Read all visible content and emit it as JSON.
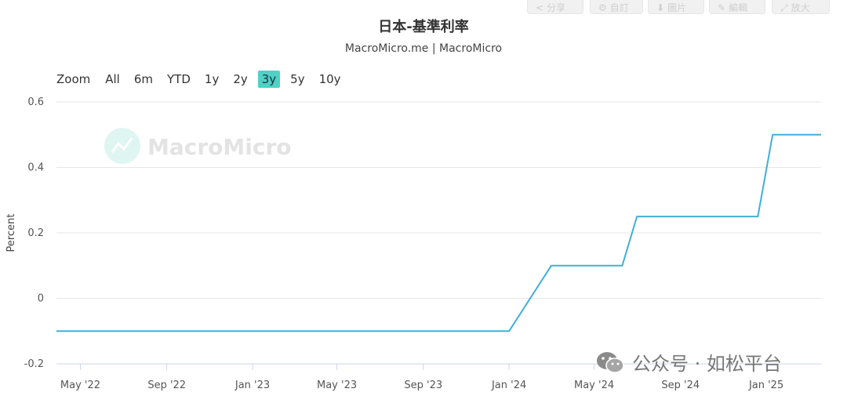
{
  "header": {
    "title": "日本-基準利率",
    "subtitle": "MacroMicro.me | MacroMicro"
  },
  "toolbar": {
    "buttons": [
      {
        "icon": "share-icon",
        "label": "分享"
      },
      {
        "icon": "gear-icon",
        "label": "自訂"
      },
      {
        "icon": "download-icon",
        "label": "圖片"
      },
      {
        "icon": "pencil-icon",
        "label": "編輯"
      },
      {
        "icon": "expand-icon",
        "label": "放大"
      }
    ]
  },
  "range_selector": {
    "zoom_label": "Zoom",
    "options": [
      "All",
      "6m",
      "YTD",
      "1y",
      "2y",
      "3y",
      "5y",
      "10y"
    ],
    "selected": "3y"
  },
  "watermark": {
    "text": "MacroMicro"
  },
  "wechat_badge": {
    "text": "公众号 · 如松平台"
  },
  "colors": {
    "line": "#41afd6",
    "accent": "#4fd1c5",
    "grid": "#e6e6e6"
  },
  "chart_data": {
    "type": "line",
    "title": "日本-基準利率",
    "subtitle": "MacroMicro.me | MacroMicro",
    "ylabel": "Percent",
    "xlabel": "",
    "ylim": [
      -0.2,
      0.6
    ],
    "yticks": [
      -0.2,
      0,
      0.2,
      0.4,
      0.6
    ],
    "ytick_labels": [
      "-0.2",
      "0",
      "0.2",
      "0.4",
      "0.6"
    ],
    "xlim": [
      "2022-03-28",
      "2025-03-20"
    ],
    "xticks": [
      "2022-05-01",
      "2022-09-01",
      "2023-01-01",
      "2023-05-01",
      "2023-09-01",
      "2024-01-01",
      "2024-05-01",
      "2024-09-01",
      "2025-01-01"
    ],
    "xtick_labels": [
      "May '22",
      "Sep '22",
      "Jan '23",
      "May '23",
      "Sep '23",
      "Jan '24",
      "May '24",
      "Sep '24",
      "Jan '25"
    ],
    "grid": true,
    "legend": "none",
    "series": [
      {
        "x": [
          "2022-03-28",
          "2024-01-01",
          "2024-03-01",
          "2024-06-10",
          "2024-07-01",
          "2024-12-20",
          "2025-01-10",
          "2025-03-20"
        ],
        "y": [
          -0.1,
          -0.1,
          0.1,
          0.1,
          0.25,
          0.25,
          0.5,
          0.5
        ]
      }
    ]
  }
}
